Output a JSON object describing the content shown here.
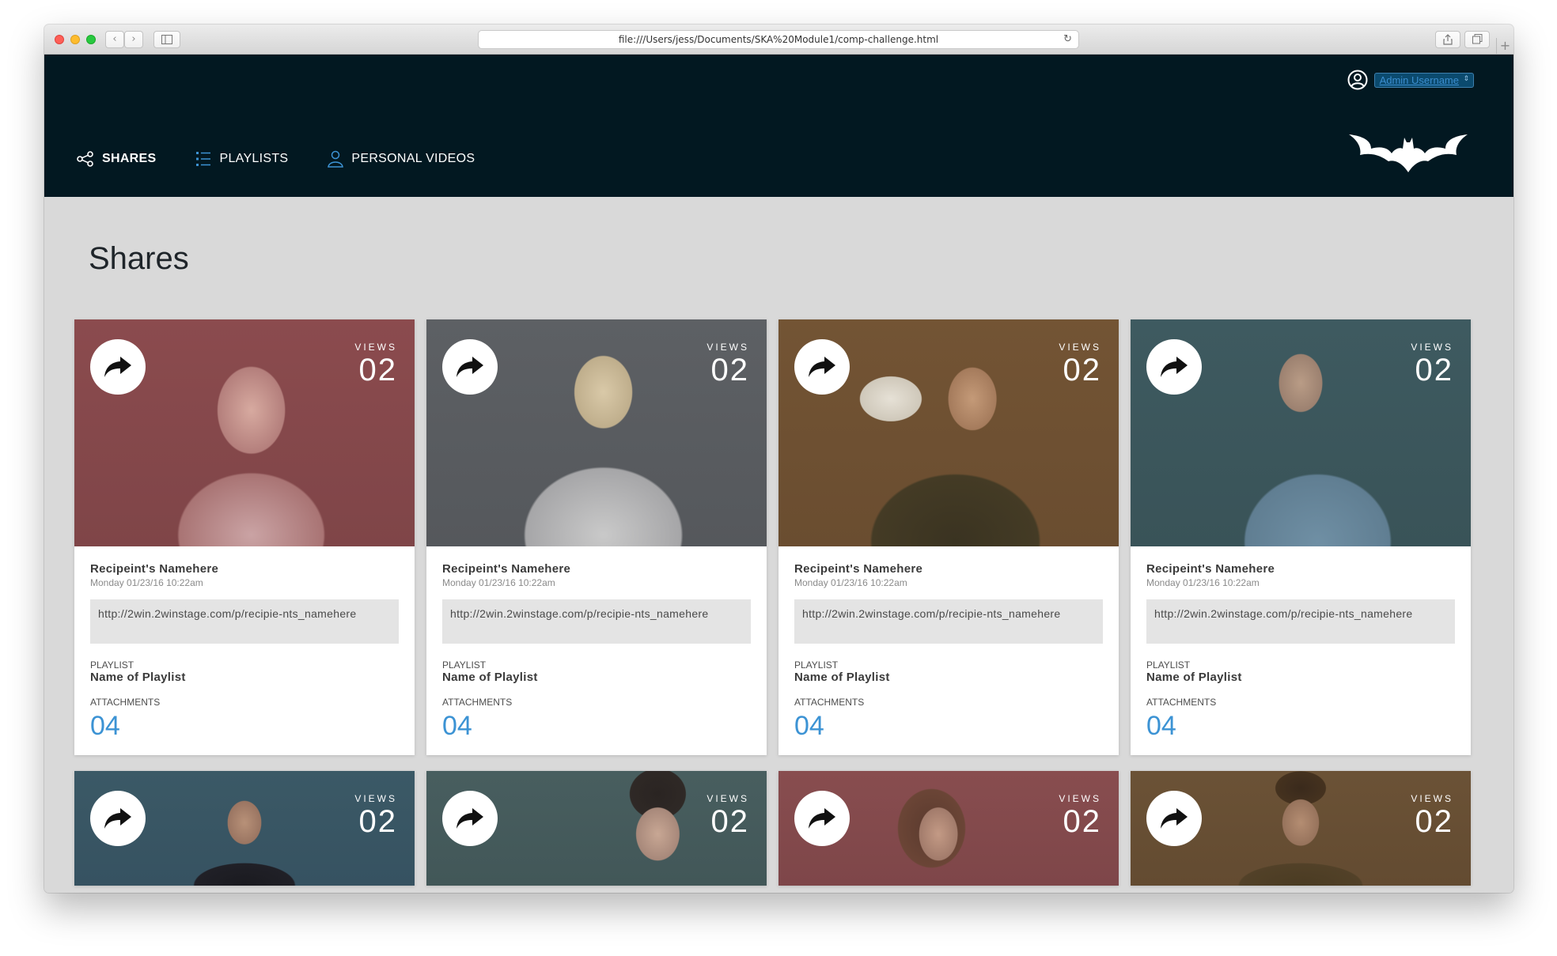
{
  "browser": {
    "url": "file:///Users/jess/Documents/SKA%20Module1/comp-challenge.html"
  },
  "header": {
    "username": "Admin Username",
    "nav": [
      {
        "label": "SHARES",
        "icon": "share-nodes-icon"
      },
      {
        "label": "PLAYLISTS",
        "icon": "list-icon"
      },
      {
        "label": "PERSONAL VIDEOS",
        "icon": "person-icon"
      }
    ],
    "logo": "bat-logo-icon"
  },
  "page": {
    "title": "Shares"
  },
  "colors": {
    "header_bg": "#021821",
    "content_bg": "#d9d9d9",
    "accent": "#3c93d4",
    "card_tints": [
      "#8b4b4e",
      "#5d6064",
      "#735434",
      "#3e5a60",
      "#3b5966",
      "#485e5f",
      "#884d4f",
      "#6b5236"
    ]
  },
  "cards": [
    {
      "views_label": "VIEWS",
      "views": "02",
      "recipient": "Recipeint's Namehere",
      "date": "Monday 01/23/16 10:22am",
      "url": "http://2win.2winstage.com/p/recipie-nts_namehere",
      "playlist_label": "PLAYLIST",
      "playlist": "Name of Playlist",
      "attachments_label": "ATTACHMENTS",
      "attachments": "04"
    },
    {
      "views_label": "VIEWS",
      "views": "02",
      "recipient": "Recipeint's Namehere",
      "date": "Monday 01/23/16 10:22am",
      "url": "http://2win.2winstage.com/p/recipie-nts_namehere",
      "playlist_label": "PLAYLIST",
      "playlist": "Name of Playlist",
      "attachments_label": "ATTACHMENTS",
      "attachments": "04"
    },
    {
      "views_label": "VIEWS",
      "views": "02",
      "recipient": "Recipeint's Namehere",
      "date": "Monday 01/23/16 10:22am",
      "url": "http://2win.2winstage.com/p/recipie-nts_namehere",
      "playlist_label": "PLAYLIST",
      "playlist": "Name of Playlist",
      "attachments_label": "ATTACHMENTS",
      "attachments": "04"
    },
    {
      "views_label": "VIEWS",
      "views": "02",
      "recipient": "Recipeint's Namehere",
      "date": "Monday 01/23/16 10:22am",
      "url": "http://2win.2winstage.com/p/recipie-nts_namehere",
      "playlist_label": "PLAYLIST",
      "playlist": "Name of Playlist",
      "attachments_label": "ATTACHMENTS",
      "attachments": "04"
    },
    {
      "views_label": "VIEWS",
      "views": "02"
    },
    {
      "views_label": "VIEWS",
      "views": "02"
    },
    {
      "views_label": "VIEWS",
      "views": "02"
    },
    {
      "views_label": "VIEWS",
      "views": "02"
    }
  ]
}
